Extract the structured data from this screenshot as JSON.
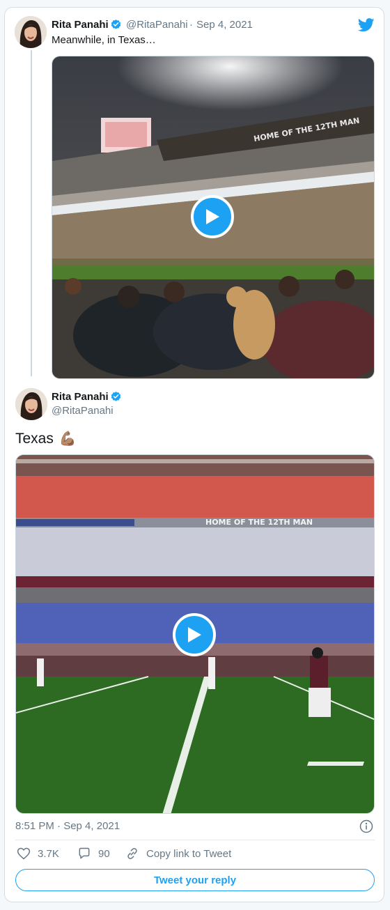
{
  "tweet1": {
    "name": "Rita Panahi",
    "handle": "@RitaPanahi",
    "separator": "·",
    "date": "Sep 4, 2021",
    "text": "Meanwhile, in Texas…",
    "media_sign": "HOME OF THE 12TH MAN"
  },
  "tweet2": {
    "name": "Rita Panahi",
    "handle": "@RitaPanahi",
    "text": "Texas",
    "emoji": "💪🏽",
    "media_sign": "HOME OF THE 12TH MAN"
  },
  "footer": {
    "time": "8:51 PM · Sep 4, 2021",
    "likes": "3.7K",
    "replies": "90",
    "copy_link": "Copy link to Tweet",
    "reply_button": "Tweet your reply"
  },
  "icons": {
    "brand": "twitter-bird-icon",
    "verified": "verified-badge-icon",
    "play": "play-icon",
    "like": "heart-icon",
    "reply": "speech-bubble-icon",
    "copy": "link-icon",
    "info": "info-icon"
  },
  "colors": {
    "accent": "#1da1f2",
    "text": "#14171a",
    "muted": "#657786",
    "border": "#ccd6dd"
  }
}
